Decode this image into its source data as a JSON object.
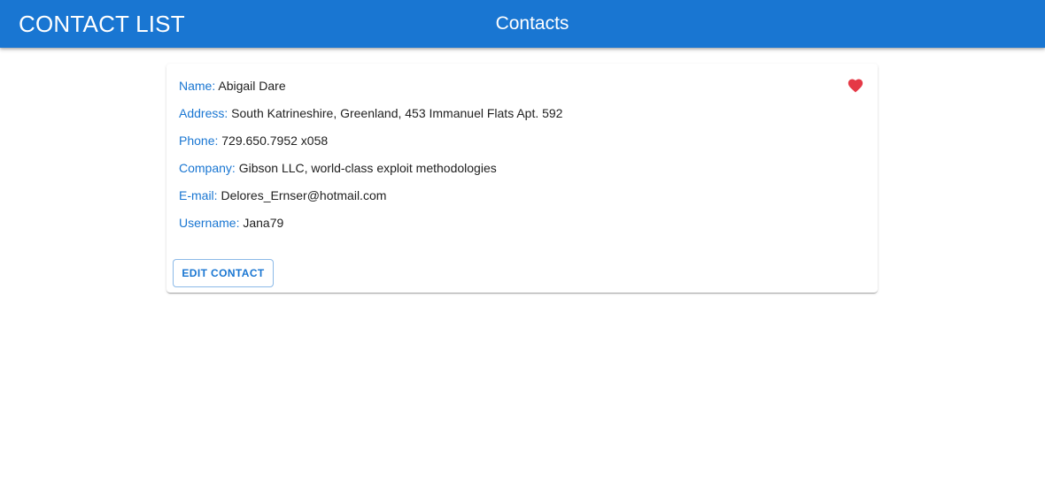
{
  "appbar": {
    "app_title": "CONTACT LIST",
    "page_title": "Contacts",
    "background_color": "#1976d2"
  },
  "contact": {
    "favorite_icon": "heart-icon",
    "favorite_color": "#e53946",
    "fields": [
      {
        "label": "Name:",
        "value": "Abigail Dare"
      },
      {
        "label": "Address:",
        "value": "South Katrineshire, Greenland, 453 Immanuel Flats Apt. 592"
      },
      {
        "label": "Phone:",
        "value": "729.650.7952 x058"
      },
      {
        "label": "Company:",
        "value": "Gibson LLC, world-class exploit methodologies"
      },
      {
        "label": "E-mail:",
        "value": "Delores_Ernser@hotmail.com"
      },
      {
        "label": "Username:",
        "value": "Jana79"
      }
    ],
    "edit_button_label": "EDIT CONTACT"
  }
}
